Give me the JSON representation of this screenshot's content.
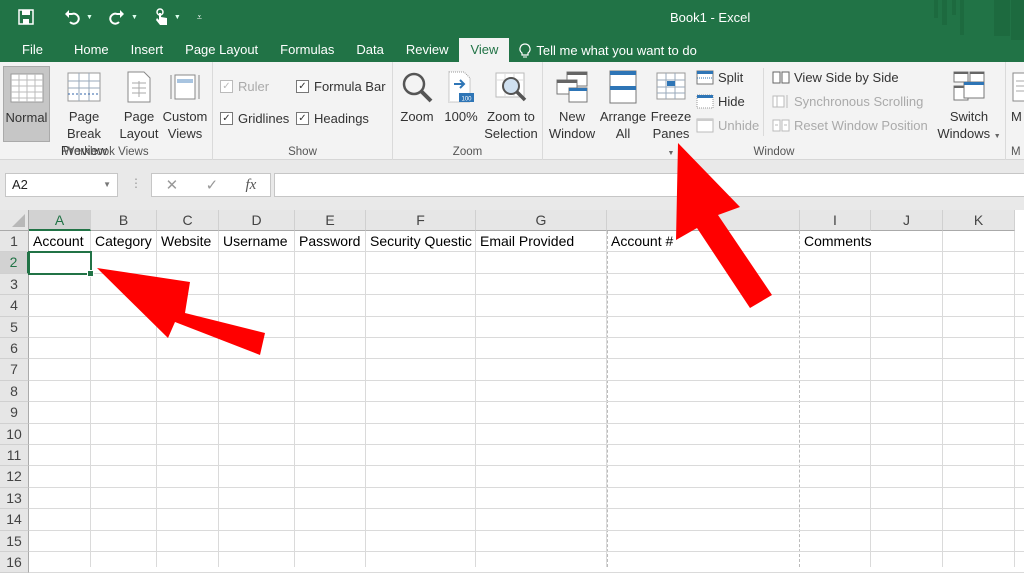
{
  "window": {
    "title": "Book1 - Excel"
  },
  "qat": {
    "save_icon": "save-icon",
    "undo_icon": "undo-icon",
    "redo_icon": "redo-icon",
    "touch_icon": "touch-mode-icon",
    "customize_icon": "customize-qat-icon"
  },
  "tabs": [
    {
      "label": "File"
    },
    {
      "label": "Home"
    },
    {
      "label": "Insert"
    },
    {
      "label": "Page Layout"
    },
    {
      "label": "Formulas"
    },
    {
      "label": "Data"
    },
    {
      "label": "Review"
    },
    {
      "label": "View",
      "active": true
    }
  ],
  "tell_me": "Tell me what you want to do",
  "ribbon": {
    "workbook_views": {
      "label": "Workbook Views",
      "normal": "Normal",
      "page_break_1": "Page Break",
      "page_break_2": "Preview",
      "page_layout_1": "Page",
      "page_layout_2": "Layout",
      "custom_1": "Custom",
      "custom_2": "Views"
    },
    "show": {
      "label": "Show",
      "ruler": {
        "label": "Ruler",
        "checked": true,
        "disabled": true
      },
      "formula_bar": {
        "label": "Formula Bar",
        "checked": true
      },
      "gridlines": {
        "label": "Gridlines",
        "checked": true
      },
      "headings": {
        "label": "Headings",
        "checked": true
      }
    },
    "zoom": {
      "label": "Zoom",
      "zoom": "Zoom",
      "hundred": "100%",
      "hundred_badge": "100",
      "zoom_sel_1": "Zoom to",
      "zoom_sel_2": "Selection"
    },
    "window": {
      "label": "Window",
      "new_1": "New",
      "new_2": "Window",
      "arrange_1": "Arrange",
      "arrange_2": "All",
      "freeze_1": "Freeze",
      "freeze_2": "Panes",
      "split": "Split",
      "hide": "Hide",
      "unhide": "Unhide",
      "side_by_side": "View Side by Side",
      "sync_scroll": "Synchronous Scrolling",
      "reset_pos": "Reset Window Position",
      "switch_1": "Switch",
      "switch_2": "Windows"
    },
    "macros": {
      "label_partial": "M",
      "button_partial": "M"
    }
  },
  "formula_bar": {
    "name_box": "A2",
    "cancel": "✕",
    "enter": "✓",
    "fx": "fx",
    "value": ""
  },
  "sheet": {
    "columns": [
      "A",
      "B",
      "C",
      "D",
      "E",
      "F",
      "G",
      "H",
      "I",
      "J",
      "K"
    ],
    "rows": [
      "1",
      "2",
      "3",
      "4",
      "5",
      "6",
      "7",
      "8",
      "9",
      "10",
      "11",
      "12",
      "13",
      "14",
      "15",
      "16"
    ],
    "selected_cell": "A2",
    "row1": {
      "A": "Account",
      "B": "Category",
      "C": "Website",
      "D": "Username",
      "E": "Password",
      "F": "Security Questic",
      "G": "Email Provided",
      "H": "Account #",
      "I": "Comments"
    }
  },
  "annotations": {
    "arrow_color": "#ff0000",
    "arrows": [
      "pointing to cell A2",
      "pointing to Freeze Panes button"
    ]
  }
}
